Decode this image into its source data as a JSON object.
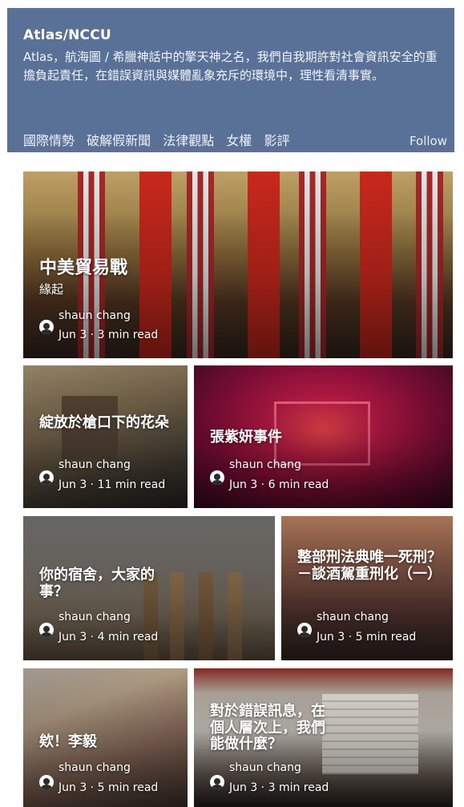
{
  "header": {
    "name": "Atlas/NCCU",
    "description": "Atlas，航海圖 / 希臘神話中的擎天神之名，我們自我期許對社會資訊安全的重擔負起責任，在錯誤資訊與媒體亂象充斥的環境中，理性看清事實。",
    "nav": [
      "國際情勢",
      "破解假新聞",
      "法律觀點",
      "女權",
      "影評"
    ],
    "follow_label": "Follow"
  },
  "articles": [
    {
      "title": "中美貿易戰",
      "subtitle": "緣起",
      "author": "shaun chang",
      "meta": "Jun 3 · 3 min read"
    },
    {
      "title": "綻放於槍口下的花朵",
      "author": "shaun chang",
      "meta": "Jun 3 · 11 min read"
    },
    {
      "title": "張紫妍事件",
      "author": "shaun chang",
      "meta": "Jun 3 · 6 min read"
    },
    {
      "title": "你的宿舍，大家的事？",
      "author": "shaun chang",
      "meta": "Jun 3 · 4 min read"
    },
    {
      "title": "整部刑法典唯一死刑？－談酒駕重刑化（一）",
      "author": "shaun chang",
      "meta": "Jun 3 · 5 min read"
    },
    {
      "title": "欸！李毅",
      "author": "shaun chang",
      "meta": "Jun 3 · 5 min read"
    },
    {
      "title": "對於錯誤訊息，在個人層次上，我們能做什麼？",
      "author": "shaun chang",
      "meta": "Jun 3 · 3 min read"
    }
  ]
}
